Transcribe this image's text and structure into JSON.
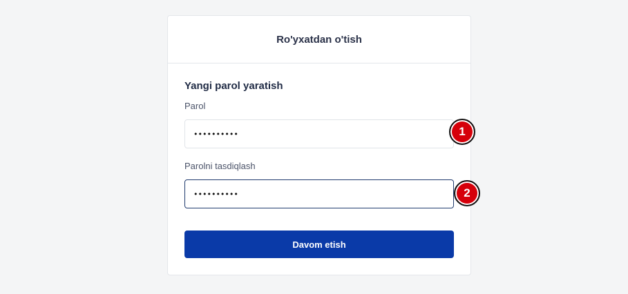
{
  "header": {
    "title": "Ro'yxatdan o'tish"
  },
  "form": {
    "section_title": "Yangi parol yaratish",
    "password_label": "Parol",
    "password_value": "••••••••••",
    "confirm_label": "Parolni tasdiqlash",
    "confirm_value": "••••••••••",
    "submit_label": "Davom etish"
  },
  "markers": [
    "1",
    "2"
  ],
  "colors": {
    "button": "#0a3aa8",
    "marker": "#d6000a",
    "focus_border": "#1f3a6e"
  }
}
